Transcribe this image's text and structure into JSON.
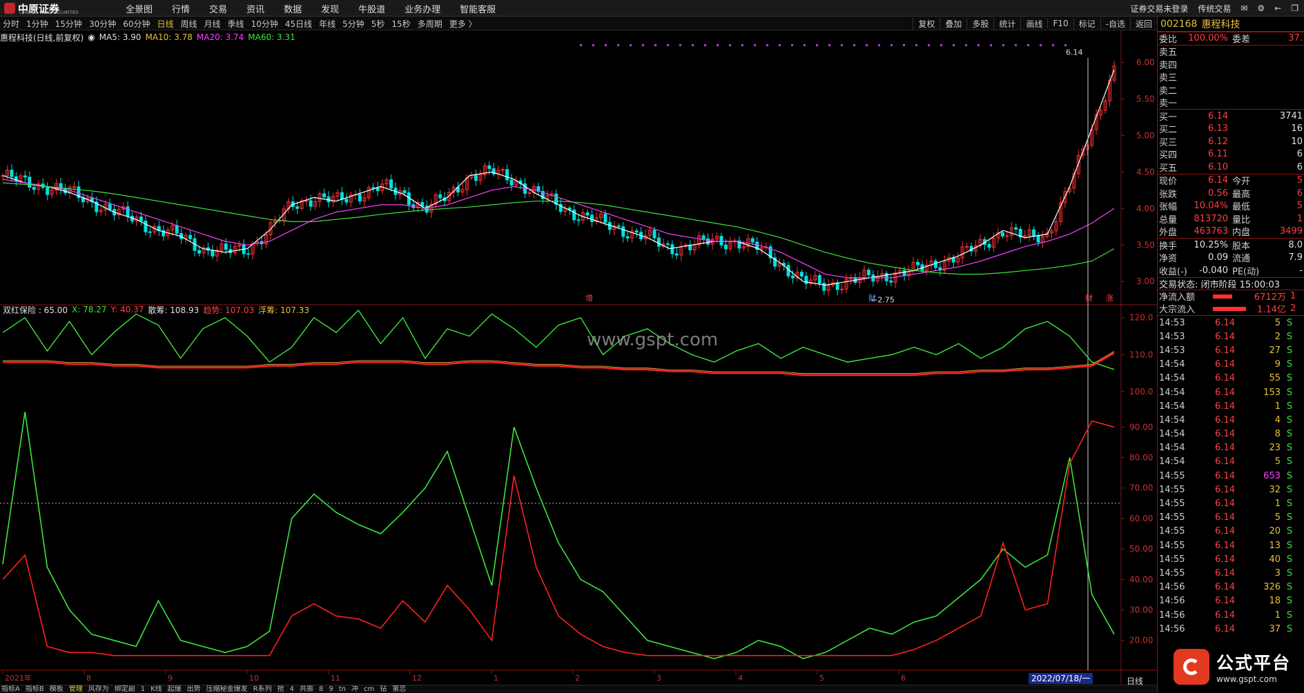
{
  "app": {
    "logo_text": "中原证券",
    "logo_sub": "CENTRAL CHINA SECURITIES",
    "nav": [
      "全景图",
      "行情",
      "交易",
      "资讯",
      "数据",
      "发现",
      "牛股道",
      "业务办理",
      "智能客服"
    ],
    "login_status": "证券交易未登录",
    "trade_mode": "传统交易"
  },
  "periods": {
    "items": [
      "分时",
      "1分钟",
      "15分钟",
      "30分钟",
      "60分钟",
      "日线",
      "周线",
      "月线",
      "季线",
      "10分钟",
      "45日线",
      "年线",
      "5分钟",
      "5秒",
      "15秒",
      "多周期",
      "更多 〉"
    ],
    "active": "日线"
  },
  "tools": [
    "复权",
    "叠加",
    "多股",
    "统计",
    "画线",
    "F10",
    "标记",
    "-自选",
    "返回"
  ],
  "legend": {
    "title": "惠程科技(日线,前复权)",
    "ma5": "MA5: 3.90",
    "ma10": "MA10: 3.78",
    "ma20": "MA20: 3.74",
    "ma60": "MA60: 3.31"
  },
  "indicator_legend": {
    "name": "双红保险 : 65.00",
    "x": "X: 78.27",
    "y": "Y: 40.37",
    "sanchou": "散筹: 108.93",
    "qushi": "趋势: 107.03",
    "fuchou": "浮筹: 107.33"
  },
  "colors": {
    "up": "#ff3030",
    "down": "#00e0e0",
    "ma5": "#ffffff",
    "ma10": "#e8c040",
    "ma20": "#ff40ff",
    "ma60": "#3ce63c",
    "green_line": "#3ce63c",
    "red_line": "#ff2020",
    "panel_border": "#8a1414"
  },
  "chart_data": {
    "type": "line",
    "price_axis": {
      "ticks": [
        "6.00",
        "5.50",
        "5.00",
        "4.50",
        "4.00",
        "3.50",
        "3.00"
      ],
      "ylim": [
        2.7,
        6.25
      ]
    },
    "price_annotations": {
      "high": "6.14",
      "low": "2.75",
      "markers": [
        "增",
        "财",
        "财",
        "涨"
      ]
    },
    "indicator_axis": {
      "ticks": [
        "120.0",
        "110.0",
        "100.0",
        "90.00",
        "80.00",
        "70.00",
        "60.00",
        "50.00",
        "40.00",
        "30.00",
        "20.00"
      ],
      "ylim": [
        12,
        125
      ],
      "dashed_level": 65
    },
    "months": [
      "2021年",
      "8",
      "9",
      "10",
      "11",
      "12",
      "1",
      "2",
      "3",
      "4",
      "5",
      "6"
    ],
    "series": [
      {
        "name": "MA5",
        "values": [
          4.45,
          4.35,
          4.3,
          4.22,
          4.1,
          3.95,
          3.85,
          3.7,
          3.62,
          3.45,
          3.4,
          3.45,
          3.7,
          4.05,
          4.15,
          4.1,
          4.2,
          4.3,
          4.2,
          4.0,
          4.15,
          4.45,
          4.5,
          4.4,
          4.2,
          4.05,
          3.9,
          3.8,
          3.7,
          3.6,
          3.45,
          3.5,
          3.55,
          3.55,
          3.45,
          3.25,
          3.0,
          2.95,
          3.0,
          3.05,
          3.1,
          3.15,
          3.25,
          3.35,
          3.5,
          3.7,
          3.6,
          3.65,
          4.3,
          5.1,
          5.9
        ]
      },
      {
        "name": "MA20",
        "values": [
          4.4,
          4.35,
          4.3,
          4.25,
          4.15,
          4.05,
          3.95,
          3.85,
          3.75,
          3.65,
          3.55,
          3.5,
          3.55,
          3.7,
          3.85,
          3.95,
          4.0,
          4.05,
          4.05,
          4.0,
          4.05,
          4.15,
          4.25,
          4.3,
          4.25,
          4.15,
          4.05,
          3.95,
          3.85,
          3.75,
          3.65,
          3.6,
          3.55,
          3.55,
          3.5,
          3.4,
          3.25,
          3.1,
          3.05,
          3.05,
          3.05,
          3.1,
          3.15,
          3.2,
          3.28,
          3.38,
          3.48,
          3.55,
          3.65,
          3.8,
          4.0
        ]
      },
      {
        "name": "MA60",
        "values": [
          4.35,
          4.33,
          4.3,
          4.27,
          4.24,
          4.2,
          4.15,
          4.1,
          4.05,
          4.0,
          3.95,
          3.9,
          3.85,
          3.82,
          3.82,
          3.85,
          3.88,
          3.92,
          3.95,
          3.98,
          4.0,
          4.02,
          4.05,
          4.08,
          4.1,
          4.1,
          4.08,
          4.05,
          4.0,
          3.95,
          3.9,
          3.85,
          3.8,
          3.75,
          3.68,
          3.6,
          3.5,
          3.4,
          3.32,
          3.25,
          3.2,
          3.15,
          3.12,
          3.1,
          3.1,
          3.12,
          3.15,
          3.18,
          3.22,
          3.28,
          3.45
        ]
      },
      {
        "name": "散筹",
        "values": [
          116,
          120,
          111,
          119,
          110,
          116,
          121,
          118,
          109,
          117,
          120,
          115,
          108,
          112,
          120,
          116,
          122,
          113,
          120,
          109,
          117,
          115,
          121,
          117,
          112,
          118,
          120,
          110,
          115,
          117,
          113,
          110,
          108,
          111,
          113,
          109,
          112,
          110,
          108,
          109,
          110,
          112,
          110,
          113,
          109,
          112,
          117,
          119,
          115,
          108,
          106
        ]
      },
      {
        "name": "趋势",
        "values": [
          108,
          108,
          108,
          107.5,
          107.5,
          107,
          107,
          106.5,
          106.5,
          106.5,
          106.5,
          106.5,
          107,
          107,
          107.5,
          107.5,
          108,
          108,
          108,
          107.5,
          107.5,
          108,
          108,
          107.5,
          107,
          107,
          106.5,
          106.5,
          106,
          106,
          105.5,
          105.5,
          105,
          105,
          105,
          105,
          104.5,
          104.5,
          104.5,
          104.5,
          104.5,
          104.5,
          105,
          105,
          105.5,
          105.5,
          106,
          106,
          106.5,
          107,
          110.5
        ]
      },
      {
        "name": "X",
        "values": [
          45,
          95,
          44,
          30,
          22,
          20,
          18,
          33,
          20,
          18,
          16,
          18,
          23,
          60,
          68,
          62,
          58,
          55,
          62,
          70,
          82,
          60,
          38,
          90,
          70,
          52,
          40,
          36,
          28,
          20,
          18,
          16,
          14,
          16,
          20,
          18,
          14,
          16,
          20,
          24,
          22,
          26,
          28,
          34,
          40,
          50,
          44,
          48,
          80,
          35,
          22
        ]
      },
      {
        "name": "Y",
        "values": [
          40,
          48,
          18,
          16,
          16,
          15,
          15,
          15,
          15,
          15,
          15,
          15,
          15,
          28,
          32,
          28,
          27,
          24,
          33,
          26,
          38,
          30,
          20,
          74,
          44,
          28,
          22,
          18,
          16,
          15,
          15,
          15,
          15,
          15,
          15,
          15,
          15,
          15,
          15,
          15,
          15,
          17,
          20,
          24,
          28,
          52,
          30,
          32,
          78,
          92,
          90
        ]
      }
    ]
  },
  "quote": {
    "code": "002168",
    "name": "惠程科技",
    "weibi_label": "委比",
    "weibi": "100.00%",
    "weicha_label": "委差",
    "weicha": "37.",
    "sells": [
      {
        "label": "卖五",
        "price": "",
        "vol": ""
      },
      {
        "label": "卖四",
        "price": "",
        "vol": ""
      },
      {
        "label": "卖三",
        "price": "",
        "vol": ""
      },
      {
        "label": "卖二",
        "price": "",
        "vol": ""
      },
      {
        "label": "卖一",
        "price": "",
        "vol": ""
      }
    ],
    "buys": [
      {
        "label": "买一",
        "price": "6.14",
        "vol": "3741"
      },
      {
        "label": "买二",
        "price": "6.13",
        "vol": "16"
      },
      {
        "label": "买三",
        "price": "6.12",
        "vol": "10"
      },
      {
        "label": "买四",
        "price": "6.11",
        "vol": "6"
      },
      {
        "label": "买五",
        "price": "6.10",
        "vol": "6"
      }
    ],
    "stats": [
      {
        "l1": "现价",
        "v1": "6.14",
        "l2": "今开",
        "v2": "5"
      },
      {
        "l1": "张跌",
        "v1": "0.56",
        "l2": "最高",
        "v2": "6"
      },
      {
        "l1": "张幅",
        "v1": "10.04%",
        "l2": "最低",
        "v2": "5"
      },
      {
        "l1": "总量",
        "v1": "813720",
        "l2": "量比",
        "v2": "1"
      },
      {
        "l1": "外盘",
        "v1": "463763",
        "l2": "内盘",
        "v2": "3499"
      }
    ],
    "stats2": [
      {
        "l1": "换手",
        "v1": "10.25%",
        "l2": "股本",
        "v2": "8.0"
      },
      {
        "l1": "净资",
        "v1": "0.09",
        "l2": "流通",
        "v2": "7.9"
      },
      {
        "l1": "收益(-)",
        "v1": "-0.040",
        "l2": "PE(动)",
        "v2": "-"
      }
    ],
    "trade_status": "交易状态: 闭市阶段 15:00:03",
    "net_inflow_label": "净流入额",
    "net_inflow": "6712万",
    "net_inflow_tail": "1",
    "big_inflow_label": "大宗流入",
    "big_inflow": "1.14亿",
    "big_inflow_tail": "2"
  },
  "ticks": [
    {
      "t": "14:53",
      "p": "6.14",
      "v": "5"
    },
    {
      "t": "14:53",
      "p": "6.14",
      "v": "2"
    },
    {
      "t": "14:53",
      "p": "6.14",
      "v": "27"
    },
    {
      "t": "14:54",
      "p": "6.14",
      "v": "9"
    },
    {
      "t": "14:54",
      "p": "6.14",
      "v": "55"
    },
    {
      "t": "14:54",
      "p": "6.14",
      "v": "153"
    },
    {
      "t": "14:54",
      "p": "6.14",
      "v": "1"
    },
    {
      "t": "14:54",
      "p": "6.14",
      "v": "4"
    },
    {
      "t": "14:54",
      "p": "6.14",
      "v": "8"
    },
    {
      "t": "14:54",
      "p": "6.14",
      "v": "23"
    },
    {
      "t": "14:54",
      "p": "6.14",
      "v": "5"
    },
    {
      "t": "14:55",
      "p": "6.14",
      "v": "653"
    },
    {
      "t": "14:55",
      "p": "6.14",
      "v": "32"
    },
    {
      "t": "14:55",
      "p": "6.14",
      "v": "1"
    },
    {
      "t": "14:55",
      "p": "6.14",
      "v": "5"
    },
    {
      "t": "14:55",
      "p": "6.14",
      "v": "20"
    },
    {
      "t": "14:55",
      "p": "6.14",
      "v": "13"
    },
    {
      "t": "14:55",
      "p": "6.14",
      "v": "40"
    },
    {
      "t": "14:55",
      "p": "6.14",
      "v": "3"
    },
    {
      "t": "14:56",
      "p": "6.14",
      "v": "326"
    },
    {
      "t": "14:56",
      "p": "6.14",
      "v": "18"
    },
    {
      "t": "14:56",
      "p": "6.14",
      "v": "1"
    },
    {
      "t": "14:56",
      "p": "6.14",
      "v": "37"
    }
  ],
  "tick_side": "S",
  "tick_highlight_index": 11,
  "bottom": {
    "tabs": [
      "指标A",
      "指标B",
      "模板",
      "管理",
      "风存为",
      "绑定副",
      "1",
      "K线",
      "起爆",
      "出势",
      "压缩秘金爆发",
      "R系列",
      "抢",
      "4",
      "共振",
      "8",
      "9",
      "tn",
      "冲",
      "cm",
      "钻",
      "第恋"
    ],
    "active": "管理",
    "right_tab": "日线"
  },
  "cursor_date": "2022/07/18/一",
  "watermark": "www.gspt.com",
  "brand": {
    "name": "公式平台",
    "url": "www.gspt.com"
  }
}
